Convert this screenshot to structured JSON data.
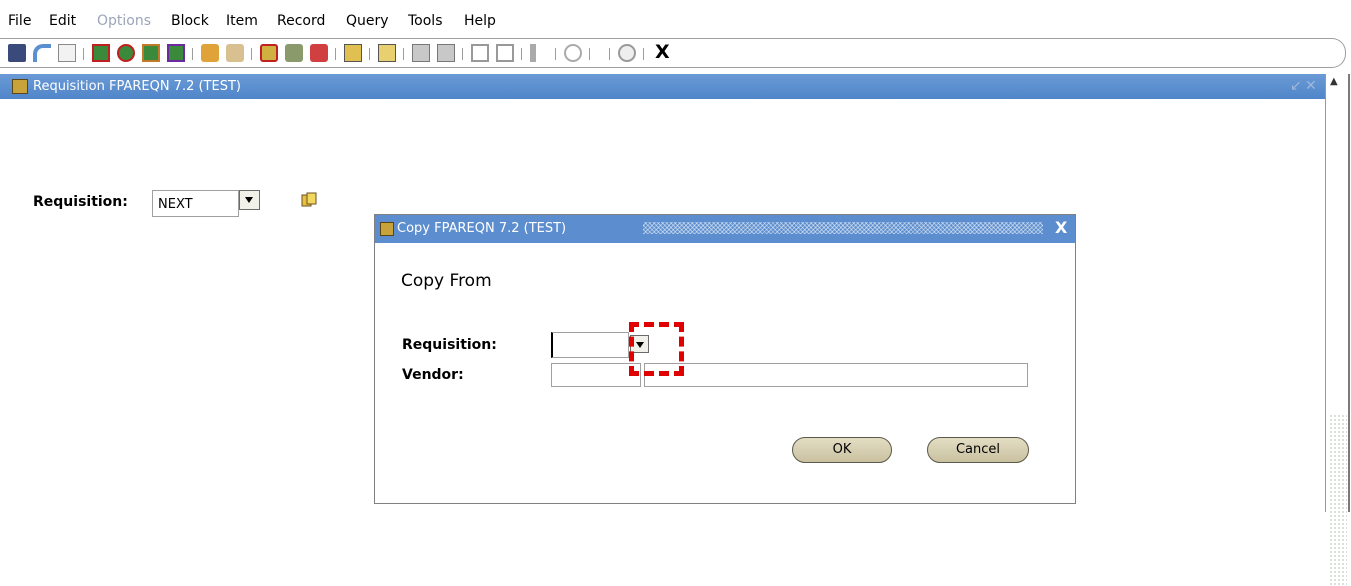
{
  "menu": [
    "File",
    "Edit",
    "Options",
    "Block",
    "Item",
    "Record",
    "Query",
    "Tools",
    "Help"
  ],
  "toolbar": {
    "icons": [
      "save-icon",
      "rollback-icon",
      "print-page-icon",
      "insert-record-icon",
      "remove-record-icon",
      "previous-block-icon",
      "next-block-icon",
      "enter-query-icon",
      "execute-query-icon",
      "help-icon",
      "lov-icon",
      "cancel-query-icon",
      "copy-icon",
      "print-icon",
      "attachments-icon",
      "export-icon",
      "navigate-icon",
      "related-icon",
      "sound-icon",
      "target-icon",
      "help-circle-icon"
    ],
    "exit_label": "X"
  },
  "window": {
    "title": "Requisition  FPAREQN  7.2  (TEST)"
  },
  "main_form": {
    "requisition_label": "Requisition:",
    "requisition_value": "NEXT"
  },
  "dialog": {
    "title": "Copy  FPAREQN  7.2  (TEST)",
    "heading": "Copy From",
    "requisition_label": "Requisition:",
    "vendor_label": "Vendor:",
    "requisition_value": "",
    "vendor_id_value": "",
    "vendor_name_value": "",
    "ok_label": "OK",
    "cancel_label": "Cancel",
    "close_label": "X"
  }
}
